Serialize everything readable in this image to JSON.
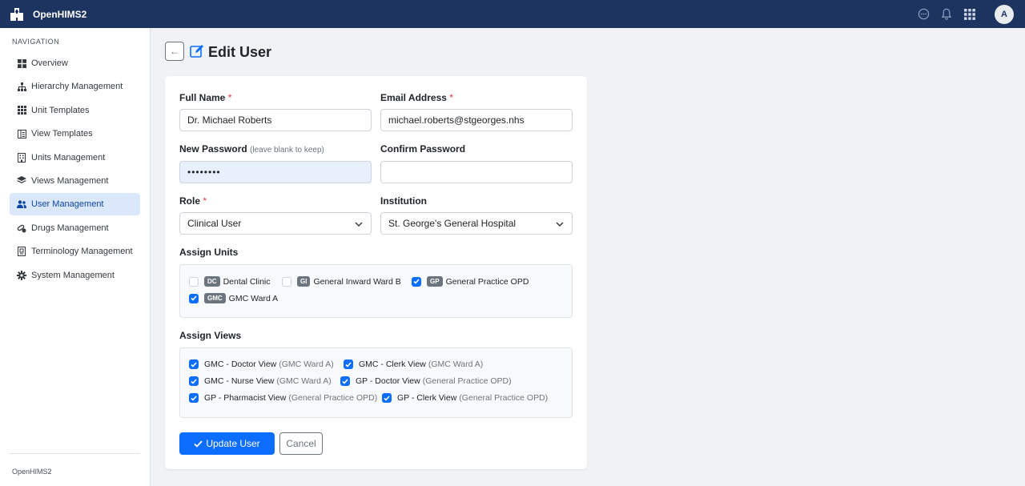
{
  "app": {
    "name": "OpenHIMS2",
    "avatar_initial": "A"
  },
  "topbar": {
    "icons": [
      "chat-icon",
      "bell-icon",
      "apps-grid-icon"
    ]
  },
  "sidebar": {
    "heading": "NAVIGATION",
    "items": [
      {
        "label": "Overview",
        "icon": "grid-icon",
        "active": false
      },
      {
        "label": "Hierarchy Management",
        "icon": "hierarchy-icon",
        "active": false
      },
      {
        "label": "Unit Templates",
        "icon": "apps-icon",
        "active": false
      },
      {
        "label": "View Templates",
        "icon": "layout-icon",
        "active": false
      },
      {
        "label": "Units Management",
        "icon": "building-icon",
        "active": false
      },
      {
        "label": "Views Management",
        "icon": "layers-icon",
        "active": false
      },
      {
        "label": "User Management",
        "icon": "users-icon",
        "active": true
      },
      {
        "label": "Drugs Management",
        "icon": "capsule-icon",
        "active": false
      },
      {
        "label": "Terminology Management",
        "icon": "book-icon",
        "active": false
      },
      {
        "label": "System Management",
        "icon": "gear-icon",
        "active": false
      }
    ],
    "footer": "OpenHIMS2"
  },
  "header": {
    "back_label": "←",
    "title": "Edit User"
  },
  "form": {
    "full_name": {
      "label": "Full Name",
      "required_mark": "*",
      "value": "Dr. Michael Roberts"
    },
    "email": {
      "label": "Email Address",
      "required_mark": "*",
      "value": "michael.roberts@stgeorges.nhs"
    },
    "new_password": {
      "label": "New Password",
      "hint": "(leave blank to keep)",
      "value": "••••••••"
    },
    "confirm_password": {
      "label": "Confirm Password",
      "value": ""
    },
    "role": {
      "label": "Role",
      "required_mark": "*",
      "value": "Clinical User"
    },
    "institution": {
      "label": "Institution",
      "value": "St. George's General Hospital"
    },
    "assign_units": {
      "label": "Assign Units",
      "units": [
        {
          "tag": "DC",
          "name": "Dental Clinic",
          "checked": false
        },
        {
          "tag": "GI",
          "name": "General Inward Ward B",
          "checked": false
        },
        {
          "tag": "GP",
          "name": "General Practice OPD",
          "checked": true
        },
        {
          "tag": "GMC",
          "name": "GMC Ward A",
          "checked": true
        }
      ]
    },
    "assign_views": {
      "label": "Assign Views",
      "views": [
        {
          "name": "GMC - Doctor View",
          "unit": "(GMC Ward A)",
          "checked": true
        },
        {
          "name": "GMC - Clerk View",
          "unit": "(GMC Ward A)",
          "checked": true
        },
        {
          "name": "GMC - Nurse View",
          "unit": "(GMC Ward A)",
          "checked": true
        },
        {
          "name": "GP - Doctor View",
          "unit": "(General Practice OPD)",
          "checked": true
        },
        {
          "name": "GP - Pharmacist View",
          "unit": "(General Practice OPD)",
          "checked": true
        },
        {
          "name": "GP - Clerk View",
          "unit": "(General Practice OPD)",
          "checked": true
        }
      ]
    },
    "submit_label": "Update User",
    "cancel_label": "Cancel"
  },
  "colors": {
    "topbar": "#1d3461",
    "primary": "#0d6efd",
    "active_nav": "#dbe7fb",
    "required": "#dc3545"
  }
}
